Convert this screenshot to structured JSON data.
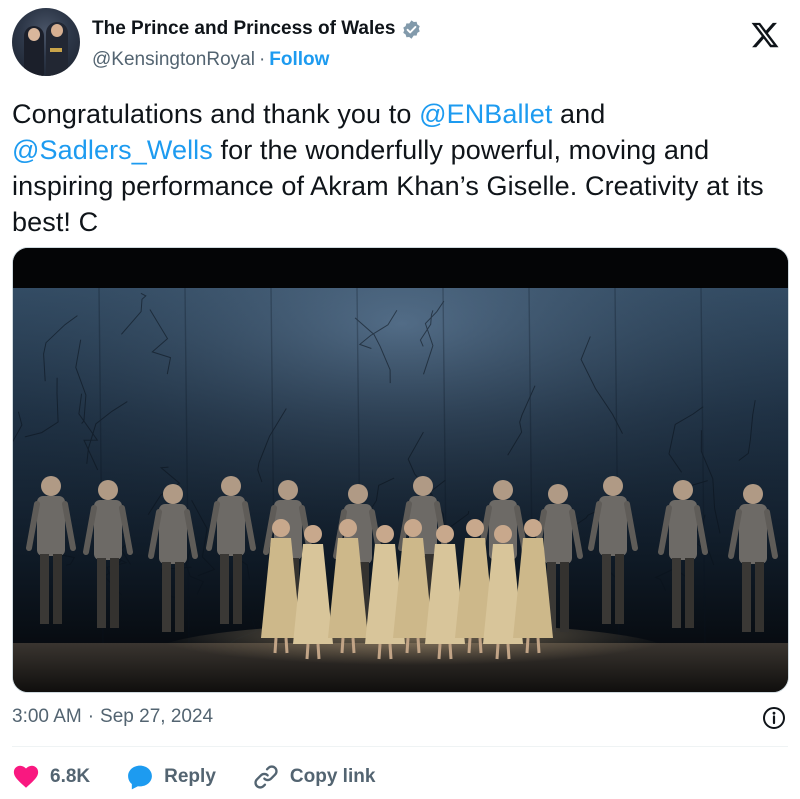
{
  "header": {
    "display_name": "The Prince and Princess of Wales",
    "handle": "@KensingtonRoyal",
    "separator": "·",
    "follow_label": "Follow"
  },
  "tweet": {
    "segments": [
      {
        "text": "Congratulations and thank you to ",
        "type": "text"
      },
      {
        "text": "@ENBallet",
        "type": "mention"
      },
      {
        "text": " and ",
        "type": "text"
      },
      {
        "text": "@Sadlers_Wells",
        "type": "mention"
      },
      {
        "text": " for the wonderfully powerful, moving and inspiring performance of Akram Khan’s Giselle. Creativity at its best! C",
        "type": "text"
      }
    ]
  },
  "meta": {
    "time": "3:00 AM",
    "separator": "·",
    "date": "Sep 27, 2024"
  },
  "actions": {
    "like_count": "6.8K",
    "reply_label": "Reply",
    "copy_link_label": "Copy link"
  },
  "icons": {
    "verified": "verified-badge-icon",
    "x_logo": "x-logo-icon",
    "info": "info-icon",
    "like": "heart-icon",
    "reply": "speech-bubble-icon",
    "link": "link-icon"
  },
  "colors": {
    "accent": "#1d9bf0",
    "like": "#f91880",
    "text": "#0f1419",
    "secondary": "#536471"
  }
}
